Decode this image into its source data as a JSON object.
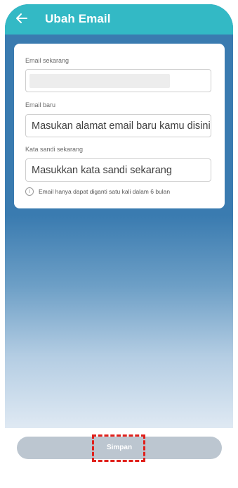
{
  "header": {
    "title": "Ubah Email",
    "back_icon": "arrow-left-icon"
  },
  "form": {
    "current_email_label": "Email sekarang",
    "new_email_label": "Email baru",
    "new_email_placeholder": "Masukan alamat email baru kamu disini",
    "password_label": "Kata sandi sekarang",
    "password_placeholder": "Masukkan kata sandi sekarang",
    "info_icon": "info-icon",
    "info_text": "Email hanya dapat diganti satu kali dalam 6 bulan"
  },
  "footer": {
    "save_label": "Simpan"
  },
  "colors": {
    "header": "#33b9c5",
    "background_top": "#3a7bb0",
    "button_disabled": "#bcc6d0",
    "highlight": "#e0201b"
  }
}
